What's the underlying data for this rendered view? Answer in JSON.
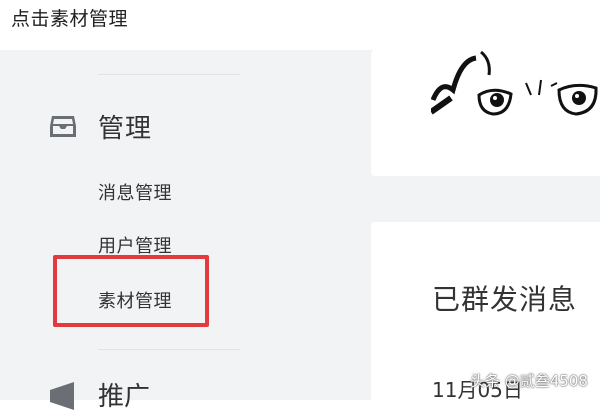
{
  "caption": "点击素材管理",
  "sidebar": {
    "group_manage": {
      "label": "管理",
      "icon": "inbox-icon"
    },
    "items": [
      {
        "label": "消息管理"
      },
      {
        "label": "用户管理"
      },
      {
        "label": "素材管理"
      }
    ],
    "group_promo": {
      "label": "推广",
      "icon": "megaphone-icon"
    }
  },
  "main": {
    "section_title": "已群发消息",
    "date": "11月05日"
  },
  "watermark": "头条 @贰叁4508",
  "colors": {
    "highlight": "#e23a3f",
    "page_bg": "#f2f3f5"
  }
}
